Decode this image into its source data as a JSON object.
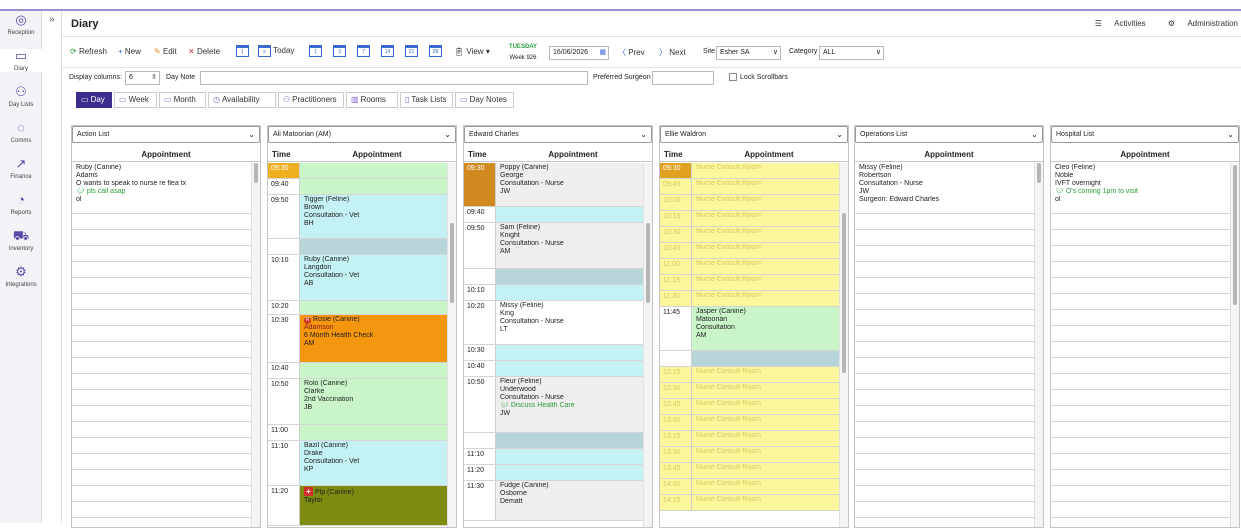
{
  "app": {
    "title": "Diary",
    "activities": "Activities",
    "administration": "Administration"
  },
  "nav": [
    {
      "label": "Reception",
      "icon": "◎"
    },
    {
      "label": "Diary",
      "icon": "▭"
    },
    {
      "label": "Day Lists",
      "icon": "⚇"
    },
    {
      "label": "Comms",
      "icon": "◌"
    },
    {
      "label": "Finance",
      "icon": "↗"
    },
    {
      "label": "Reports",
      "icon": "◔"
    },
    {
      "label": "Inventory",
      "icon": "⛟"
    },
    {
      "label": "Integrations",
      "icon": "⚙"
    }
  ],
  "toolbar": {
    "refresh": "Refresh",
    "new": "New",
    "edit": "Edit",
    "delete": "Delete",
    "today": "Today",
    "view": "View",
    "day_name": "TUESDAY",
    "week": "Week 926",
    "date": "16/06/2026",
    "prev": "Prev",
    "next": "Next",
    "site_label": "Site",
    "site_value": "Esher SA",
    "category_label": "Category",
    "category_value": "ALL"
  },
  "options": {
    "display_columns_label": "Display columns:",
    "display_columns_value": "6",
    "day_note_label": "Day Note",
    "preferred_surgeon_label": "Preferred Surgeon",
    "lock_scrollbars": "Lock Scrollbars"
  },
  "tabs": [
    "Day",
    "Week",
    "Month",
    "Availability",
    "Practitioners",
    "Rooms",
    "Task Lists",
    "Day Notes"
  ],
  "headers": {
    "time": "Time",
    "appointment": "Appointment"
  },
  "columns": [
    {
      "name": "Action List",
      "type": "list",
      "rows": [
        {
          "h": 51,
          "lines": [
            "Ruby (Canine)",
            "Adams",
            "O wants to speak to nurse re flea tx",
            "pls call asap",
            "ol"
          ],
          "note_idx": [
            3
          ]
        }
      ]
    },
    {
      "name": "Ali Matoorian (AM)",
      "type": "diary",
      "rows": [
        {
          "t": "09:30",
          "h": 16,
          "bg": "#c9f5c9",
          "tbg": "#eeb020",
          "lines": []
        },
        {
          "t": "09:40",
          "h": 16,
          "bg": "#c9f5c9",
          "lines": []
        },
        {
          "t": "09:50",
          "h": 44,
          "bg": "#c4f1f3",
          "lines": [
            "Tigger (Feline)",
            "Brown",
            "Consultation - Vet",
            "BH"
          ]
        },
        {
          "t": "",
          "h": 16,
          "bg": "#b7d4d8",
          "lines": []
        },
        {
          "t": "10:10",
          "h": 46,
          "bg": "#c4f1f3",
          "lines": [
            "Ruby (Canine)",
            "Langdon",
            "Consultation - Vet",
            "AB"
          ]
        },
        {
          "t": "10:20",
          "h": 14,
          "bg": "#c9f5c9",
          "lines": []
        },
        {
          "t": "10:30",
          "h": 48,
          "bg": "#f5960f",
          "lines": [
            "Rosie (Canine)",
            "Adamson",
            "6 Month Health Check",
            "AM"
          ],
          "badge": "R"
        },
        {
          "t": "10:40",
          "h": 16,
          "bg": "#c9f5c9",
          "lines": []
        },
        {
          "t": "10:50",
          "h": 46,
          "bg": "#c9f5c9",
          "lines": [
            "Rolo (Canine)",
            "Clarke",
            "2nd Vaccination",
            "JB"
          ]
        },
        {
          "t": "11:00",
          "h": 16,
          "bg": "#c9f5c9",
          "lines": []
        },
        {
          "t": "11:10",
          "h": 45,
          "bg": "#c4f1f3",
          "lines": [
            "Bazil (Canine)",
            "Drake",
            "Consultation - Vet",
            "KP"
          ]
        },
        {
          "t": "11:20",
          "h": 40,
          "bg": "#7d8c10",
          "lines": [
            "Pip (Canine)",
            "Taylor"
          ],
          "cross": true
        }
      ]
    },
    {
      "name": "Edward Charles",
      "type": "diary",
      "rows": [
        {
          "t": "09:30",
          "h": 44,
          "bg": "#eeeeee",
          "tbg": "#d08a20",
          "lines": [
            "Poppy (Canine)",
            "George",
            "Consultation - Nurse",
            "JW"
          ]
        },
        {
          "t": "09:40",
          "h": 16,
          "bg": "#c4f1f3",
          "lines": []
        },
        {
          "t": "09:50",
          "h": 46,
          "bg": "#eeeeee",
          "lines": [
            "Sam (Feline)",
            "Knight",
            "Consultation - Nurse",
            "AM"
          ]
        },
        {
          "t": "",
          "h": 16,
          "bg": "#b7d4d8",
          "lines": []
        },
        {
          "t": "10:10",
          "h": 16,
          "bg": "#c4f1f3",
          "lines": []
        },
        {
          "t": "10:20",
          "h": 44,
          "bg": "#ffffff",
          "lines": [
            "Missy (Feline)",
            "King",
            "Consultation - Nurse",
            "LT"
          ]
        },
        {
          "t": "10:30",
          "h": 16,
          "bg": "#c4f1f3",
          "lines": []
        },
        {
          "t": "10:40",
          "h": 16,
          "bg": "#c4f1f3",
          "lines": []
        },
        {
          "t": "10:50",
          "h": 56,
          "bg": "#eeeeee",
          "lines": [
            "Fleur (Feline)",
            "Underwood",
            "Consultation - Nurse",
            "Discuss Health Care",
            "JW"
          ],
          "note_idx": [
            3
          ]
        },
        {
          "t": "",
          "h": 16,
          "bg": "#b7d4d8",
          "lines": []
        },
        {
          "t": "11:10",
          "h": 16,
          "bg": "#c4f1f3",
          "lines": []
        },
        {
          "t": "11:20",
          "h": 16,
          "bg": "#c4f1f3",
          "lines": []
        },
        {
          "t": "11:30",
          "h": 40,
          "bg": "#eeeeee",
          "lines": [
            "Fudge (Canine)",
            "Osborne",
            "Dematt"
          ]
        }
      ]
    },
    {
      "name": "Ellie Waldron",
      "type": "diary",
      "rows": [
        {
          "t": "09:30",
          "h": 16,
          "bg": "#fbf79a",
          "tbg": "#e0a020",
          "lines": [
            "Nurse Consult Room"
          ],
          "nurse": true
        },
        {
          "t": "09:45",
          "h": 16,
          "bg": "#fbf79a",
          "lines": [
            "Nurse Consult Room"
          ],
          "nurse": true
        },
        {
          "t": "10:00",
          "h": 16,
          "bg": "#fbf79a",
          "lines": [
            "Nurse Consult Room"
          ],
          "nurse": true
        },
        {
          "t": "10:15",
          "h": 16,
          "bg": "#fbf79a",
          "lines": [
            "Nurse Consult Room"
          ],
          "nurse": true
        },
        {
          "t": "10:30",
          "h": 16,
          "bg": "#fbf79a",
          "lines": [
            "Nurse Consult Room"
          ],
          "nurse": true
        },
        {
          "t": "10:45",
          "h": 16,
          "bg": "#fbf79a",
          "lines": [
            "Nurse Consult Room"
          ],
          "nurse": true
        },
        {
          "t": "11:00",
          "h": 16,
          "bg": "#fbf79a",
          "lines": [
            "Nurse Consult Room"
          ],
          "nurse": true
        },
        {
          "t": "11:15",
          "h": 16,
          "bg": "#fbf79a",
          "lines": [
            "Nurse Consult Room"
          ],
          "nurse": true
        },
        {
          "t": "11:30",
          "h": 16,
          "bg": "#fbf79a",
          "lines": [
            "Nurse Consult Room"
          ],
          "nurse": true
        },
        {
          "t": "11:45",
          "h": 44,
          "bg": "#c9f5c9",
          "lines": [
            "Jasper (Canine)",
            "Matoorian",
            "Consultation",
            "AM"
          ]
        },
        {
          "t": "",
          "h": 16,
          "bg": "#b7d4d8",
          "lines": []
        },
        {
          "t": "12:15",
          "h": 16,
          "bg": "#fbf79a",
          "lines": [
            "Nurse Consult Room"
          ],
          "nurse": true
        },
        {
          "t": "12:30",
          "h": 16,
          "bg": "#fbf79a",
          "lines": [
            "Nurse Consult Room"
          ],
          "nurse": true
        },
        {
          "t": "12:45",
          "h": 16,
          "bg": "#fbf79a",
          "lines": [
            "Nurse Consult Room"
          ],
          "nurse": true
        },
        {
          "t": "13:00",
          "h": 16,
          "bg": "#fbf79a",
          "lines": [
            "Nurse Consult Room"
          ],
          "nurse": true
        },
        {
          "t": "13:15",
          "h": 16,
          "bg": "#fbf79a",
          "lines": [
            "Nurse Consult Room"
          ],
          "nurse": true
        },
        {
          "t": "13:30",
          "h": 16,
          "bg": "#fbf79a",
          "lines": [
            "Nurse Consult Room"
          ],
          "nurse": true
        },
        {
          "t": "13:45",
          "h": 16,
          "bg": "#fbf79a",
          "lines": [
            "Nurse Consult Room"
          ],
          "nurse": true
        },
        {
          "t": "14:00",
          "h": 16,
          "bg": "#fbf79a",
          "lines": [
            "Nurse Consult Room"
          ],
          "nurse": true
        },
        {
          "t": "14:15",
          "h": 16,
          "bg": "#fbf79a",
          "lines": [
            "Nurse Consult Room"
          ],
          "nurse": true
        }
      ]
    },
    {
      "name": "Operations List",
      "type": "list",
      "rows": [
        {
          "h": 51,
          "lines": [
            "Missy (Feline)",
            "Robertson",
            "Consultation - Nurse",
            "JW",
            "Surgeon: Edward Charles"
          ]
        }
      ]
    },
    {
      "name": "Hospital List",
      "type": "list",
      "rows": [
        {
          "h": 51,
          "lines": [
            "Cleo (Feline)",
            "Noble",
            "IVFT overnight",
            "O's coming 1pm to visit",
            "ol"
          ],
          "note_idx": [
            3
          ]
        }
      ]
    }
  ]
}
